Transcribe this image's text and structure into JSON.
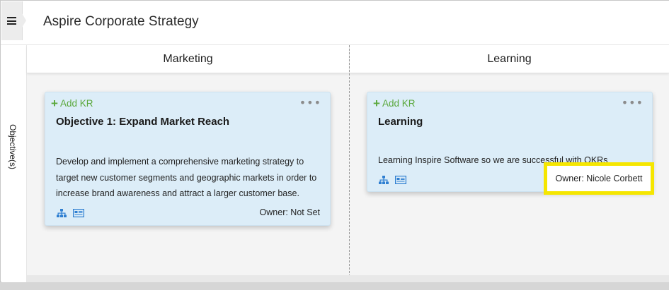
{
  "header": {
    "title": "Aspire Corporate Strategy"
  },
  "sidebar": {
    "label": "Objective(s)"
  },
  "columns": [
    {
      "name": "Marketing"
    },
    {
      "name": "Learning"
    }
  ],
  "cards": [
    {
      "add_kr_label": "Add KR",
      "title": "Objective 1: Expand Market Reach",
      "description": "Develop and implement a comprehensive marketing strategy to target new customer segments and geographic markets in order to increase brand awareness and attract a larger customer base.",
      "owner": "Owner: Not Set"
    },
    {
      "add_kr_label": "Add KR",
      "title": "Learning",
      "description": "Learning Inspire Software so we are successful with OKRs",
      "owner": "Owner: Nicole Corbett"
    }
  ],
  "icons": {
    "hierarchy": "org-chart-icon",
    "details": "card-details-icon",
    "more": "more-options-icon",
    "menu": "hamburger-menu-icon"
  },
  "colors": {
    "add_kr": "#5aa83c",
    "card_bg": "#dcedf8",
    "icon_blue": "#2f7fd1",
    "highlight": "#f5e600"
  }
}
